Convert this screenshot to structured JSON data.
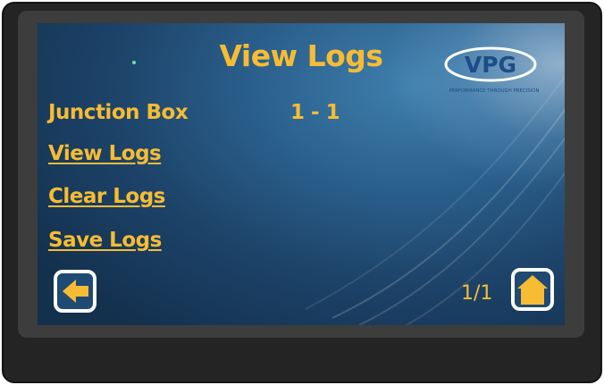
{
  "screen": {
    "title": "View Logs",
    "logo": {
      "text": "VPG",
      "tagline": "PERFORMANCE THROUGH PRECISION"
    },
    "junction_box": {
      "label": "Junction Box",
      "value": "1 - 1"
    },
    "links": [
      "View Logs",
      "Clear Logs",
      "Save Logs"
    ],
    "page_indicator": "1/1"
  },
  "icons": {
    "back": "arrow-left-icon",
    "home": "house-icon"
  },
  "colors": {
    "accent": "#f7bc33",
    "button_border": "#ffffff",
    "bezel": "#242424"
  }
}
